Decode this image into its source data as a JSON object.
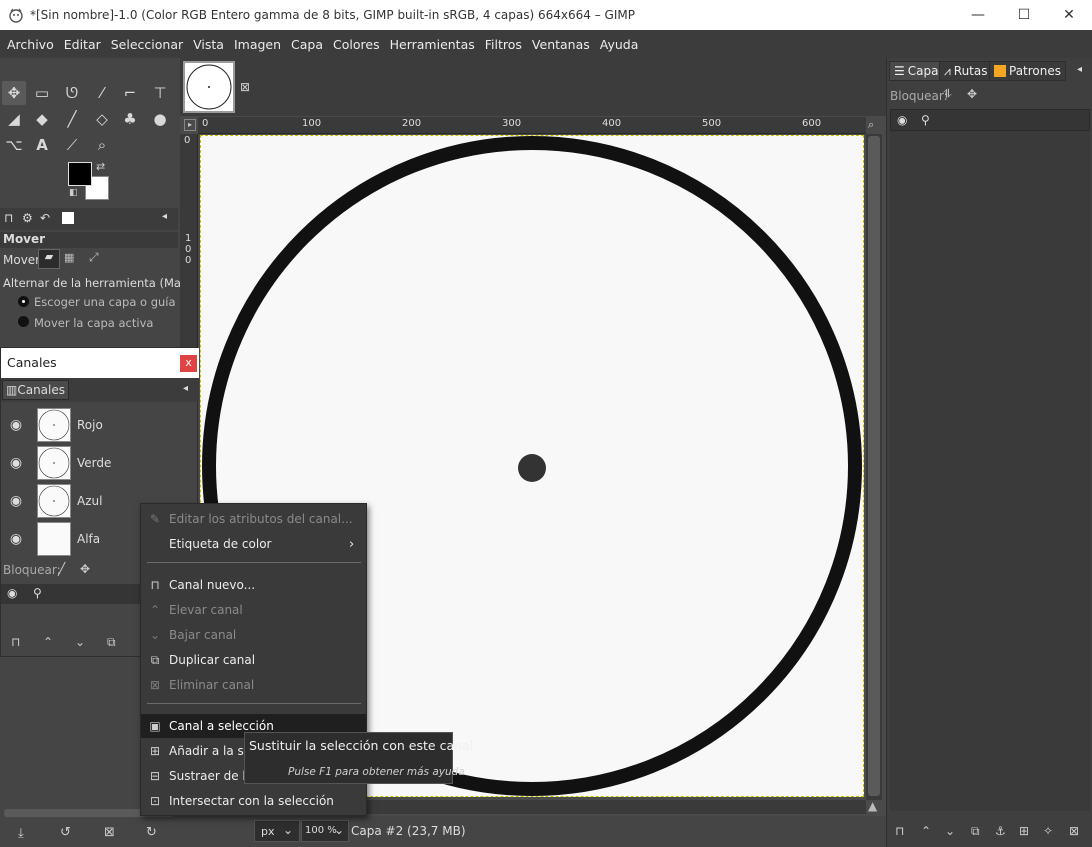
{
  "window": {
    "title": "*[Sin nombre]-1.0 (Color RGB Entero gamma de 8 bits, GIMP built-in sRGB, 4 capas) 664x664 – GIMP",
    "minimize": "—",
    "maximize": "☐",
    "close": "✕"
  },
  "menubar": [
    "Archivo",
    "Editar",
    "Seleccionar",
    "Vista",
    "Imagen",
    "Capa",
    "Colores",
    "Herramientas",
    "Filtros",
    "Ventanas",
    "Ayuda"
  ],
  "tool_options": {
    "title": "Mover",
    "mover_label": "Mover:",
    "toggle_label": "Alternar de la herramienta  (Mayús)",
    "option1": "Escoger una capa o guía",
    "option2": "Mover la capa activa"
  },
  "channels_dialog": {
    "window_title": "Canales",
    "close": "x",
    "tab_label": "Canales",
    "channels": [
      "Rojo",
      "Verde",
      "Azul",
      "Alfa"
    ],
    "lock_label": "Bloquear:"
  },
  "context_menu": {
    "items": [
      {
        "label": "Editar los atributos del canal...",
        "enabled": false,
        "icon": "edit-icon"
      },
      {
        "label": "Etiqueta de color",
        "enabled": true,
        "icon": "",
        "submenu": true
      },
      {
        "label": "Canal nuevo...",
        "enabled": true,
        "icon": "new-channel-icon"
      },
      {
        "label": "Elevar canal",
        "enabled": false,
        "icon": "chevron-up-icon"
      },
      {
        "label": "Bajar canal",
        "enabled": false,
        "icon": "chevron-down-icon"
      },
      {
        "label": "Duplicar canal",
        "enabled": true,
        "icon": "duplicate-icon"
      },
      {
        "label": "Eliminar canal",
        "enabled": false,
        "icon": "delete-icon"
      },
      {
        "label": "Canal a selección",
        "enabled": true,
        "icon": "channel-to-selection-icon",
        "highlighted": true
      },
      {
        "label": "Añadir a la selección",
        "enabled": true,
        "icon": "add-selection-icon"
      },
      {
        "label": "Sustraer de la selección",
        "enabled": true,
        "icon": "subtract-selection-icon"
      },
      {
        "label": "Intersectar con la selección",
        "enabled": true,
        "icon": "intersect-selection-icon"
      }
    ]
  },
  "tooltip": {
    "text": "Sustituir la selección con este canal",
    "help": "Pulse F1 para obtener más ayuda"
  },
  "rulers": {
    "top": [
      "0",
      "100",
      "200",
      "300",
      "400",
      "500",
      "600"
    ],
    "left_top": "0",
    "left_100": [
      "1",
      "0",
      "0"
    ]
  },
  "statusbar": {
    "unit": "px",
    "zoom": "100 %",
    "info": "Capa #2 (23,7 MB)"
  },
  "right_dock": {
    "tabs": [
      "Capas",
      "Rutas",
      "Patrones"
    ],
    "lock_label": "Bloquear:"
  },
  "colors": {
    "accent": "#3c3c3c",
    "patterns_tab": "#f5a623"
  }
}
